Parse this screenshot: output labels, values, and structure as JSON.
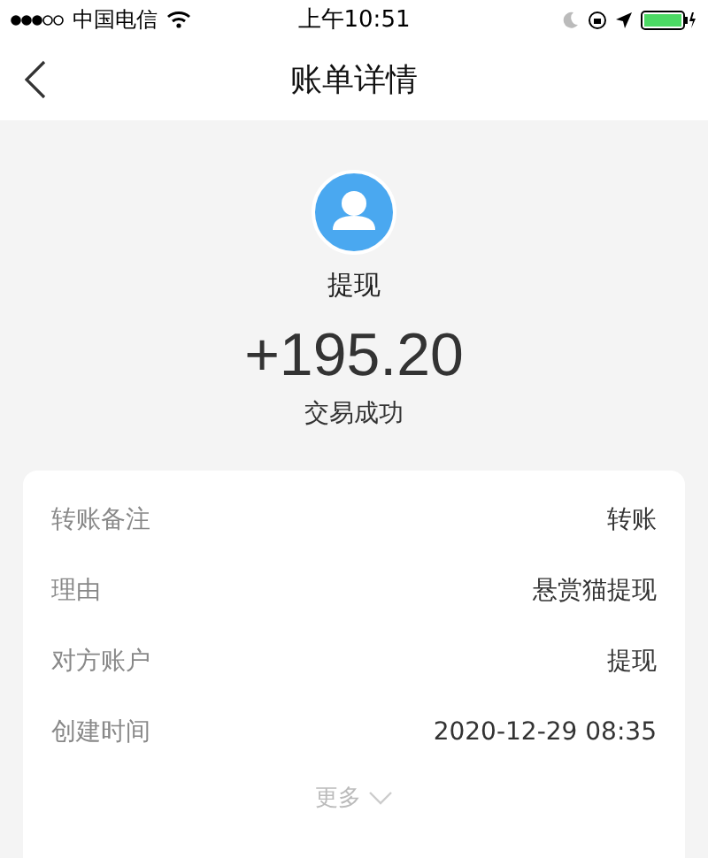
{
  "status_bar": {
    "carrier": "中国电信",
    "time": "上午10:51"
  },
  "nav": {
    "title": "账单详情"
  },
  "summary": {
    "name": "提现",
    "amount": "+195.20",
    "status": "交易成功"
  },
  "details": [
    {
      "label": "转账备注",
      "value": "转账"
    },
    {
      "label": "理由",
      "value": "悬赏猫提现"
    },
    {
      "label": "对方账户",
      "value": "提现"
    },
    {
      "label": "创建时间",
      "value": "2020-12-29 08:35"
    }
  ],
  "more": "更多"
}
